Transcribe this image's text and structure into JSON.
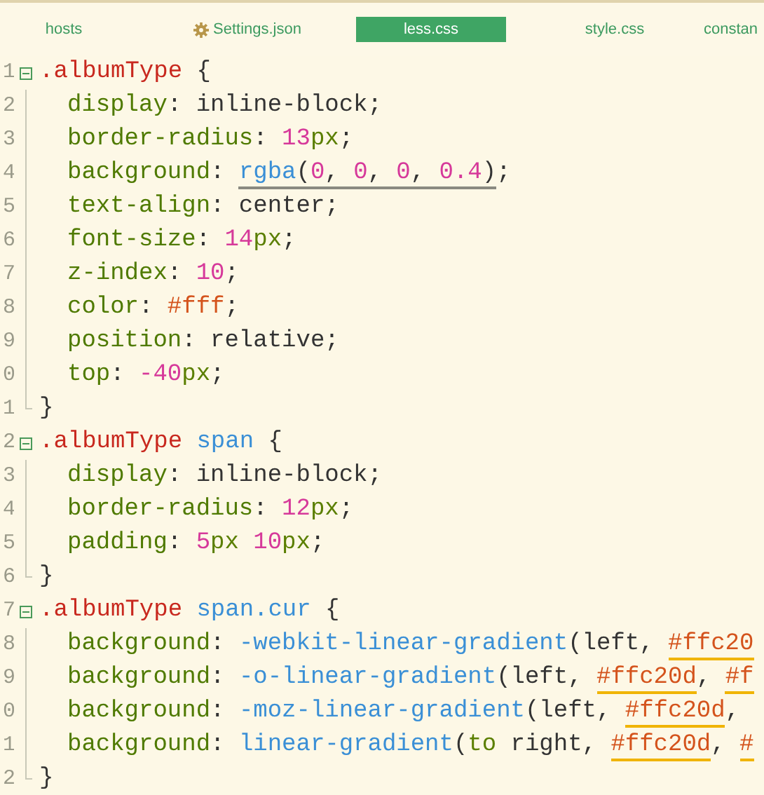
{
  "tabs": [
    {
      "label": "hosts",
      "selected": false
    },
    {
      "label": "Settings.json",
      "selected": false
    },
    {
      "label": "less.css",
      "selected": true
    },
    {
      "label": "style.css",
      "selected": false
    },
    {
      "label": "constan",
      "selected": false
    }
  ],
  "lines": [
    {
      "number": "1",
      "kind": "open",
      "tokens": [
        {
          "text": ".albumType",
          "kind": "selector"
        },
        {
          "text": " {",
          "kind": "plain"
        }
      ]
    },
    {
      "number": "2",
      "kind": "body",
      "tokens": [
        {
          "text": "display",
          "kind": "property"
        },
        {
          "text": ": inline-block;",
          "kind": "plain"
        }
      ]
    },
    {
      "number": "3",
      "kind": "body",
      "tokens": [
        {
          "text": "border-radius",
          "kind": "property"
        },
        {
          "text": ": ",
          "kind": "plain"
        },
        {
          "text": "13",
          "kind": "number"
        },
        {
          "text": "px",
          "kind": "unit"
        },
        {
          "text": ";",
          "kind": "plain"
        }
      ]
    },
    {
      "number": "4",
      "kind": "body",
      "tokens": [
        {
          "text": "background",
          "kind": "property"
        },
        {
          "text": ": ",
          "kind": "plain"
        },
        {
          "text": "rgba",
          "kind": "function",
          "underlined": true
        },
        {
          "text": "(",
          "kind": "plain",
          "underlined": true
        },
        {
          "text": "0",
          "kind": "number",
          "underlined": true
        },
        {
          "text": ", ",
          "kind": "plain",
          "underlined": true
        },
        {
          "text": "0",
          "kind": "number",
          "underlined": true
        },
        {
          "text": ", ",
          "kind": "plain",
          "underlined": true
        },
        {
          "text": "0",
          "kind": "number",
          "underlined": true
        },
        {
          "text": ", ",
          "kind": "plain",
          "underlined": true
        },
        {
          "text": "0.4",
          "kind": "number",
          "underlined": true
        },
        {
          "text": ")",
          "kind": "plain",
          "underlined": true
        },
        {
          "text": ";",
          "kind": "plain"
        }
      ]
    },
    {
      "number": "5",
      "kind": "body",
      "tokens": [
        {
          "text": "text-align",
          "kind": "property"
        },
        {
          "text": ": center;",
          "kind": "plain"
        }
      ]
    },
    {
      "number": "6",
      "kind": "body",
      "tokens": [
        {
          "text": "font-size",
          "kind": "property"
        },
        {
          "text": ": ",
          "kind": "plain"
        },
        {
          "text": "14",
          "kind": "number"
        },
        {
          "text": "px",
          "kind": "unit"
        },
        {
          "text": ";",
          "kind": "plain"
        }
      ]
    },
    {
      "number": "7",
      "kind": "body",
      "tokens": [
        {
          "text": "z-index",
          "kind": "property"
        },
        {
          "text": ": ",
          "kind": "plain"
        },
        {
          "text": "10",
          "kind": "number"
        },
        {
          "text": ";",
          "kind": "plain"
        }
      ]
    },
    {
      "number": "8",
      "kind": "body",
      "tokens": [
        {
          "text": "color",
          "kind": "property"
        },
        {
          "text": ": ",
          "kind": "plain"
        },
        {
          "text": "#fff",
          "kind": "hex"
        },
        {
          "text": ";",
          "kind": "plain"
        }
      ]
    },
    {
      "number": "9",
      "kind": "body",
      "tokens": [
        {
          "text": "position",
          "kind": "property"
        },
        {
          "text": ": relative;",
          "kind": "plain"
        }
      ]
    },
    {
      "number": "0",
      "kind": "body",
      "tokens": [
        {
          "text": "top",
          "kind": "property"
        },
        {
          "text": ": ",
          "kind": "plain"
        },
        {
          "text": "-40",
          "kind": "number"
        },
        {
          "text": "px",
          "kind": "unit"
        },
        {
          "text": ";",
          "kind": "plain"
        }
      ]
    },
    {
      "number": "1",
      "kind": "close",
      "tokens": [
        {
          "text": "}",
          "kind": "plain"
        }
      ]
    },
    {
      "number": "2",
      "kind": "open",
      "tokens": [
        {
          "text": ".albumType ",
          "kind": "selector"
        },
        {
          "text": "span",
          "kind": "function"
        },
        {
          "text": " {",
          "kind": "plain"
        }
      ]
    },
    {
      "number": "3",
      "kind": "body",
      "tokens": [
        {
          "text": "display",
          "kind": "property"
        },
        {
          "text": ": inline-block;",
          "kind": "plain"
        }
      ]
    },
    {
      "number": "4",
      "kind": "body",
      "tokens": [
        {
          "text": "border-radius",
          "kind": "property"
        },
        {
          "text": ": ",
          "kind": "plain"
        },
        {
          "text": "12",
          "kind": "number"
        },
        {
          "text": "px",
          "kind": "unit"
        },
        {
          "text": ";",
          "kind": "plain"
        }
      ]
    },
    {
      "number": "5",
      "kind": "body",
      "tokens": [
        {
          "text": "padding",
          "kind": "property"
        },
        {
          "text": ": ",
          "kind": "plain"
        },
        {
          "text": "5",
          "kind": "number"
        },
        {
          "text": "px ",
          "kind": "unit"
        },
        {
          "text": "10",
          "kind": "number"
        },
        {
          "text": "px",
          "kind": "unit"
        },
        {
          "text": ";",
          "kind": "plain"
        }
      ]
    },
    {
      "number": "6",
      "kind": "close",
      "tokens": [
        {
          "text": "}",
          "kind": "plain"
        }
      ]
    },
    {
      "number": "7",
      "kind": "open",
      "tokens": [
        {
          "text": ".albumType ",
          "kind": "selector"
        },
        {
          "text": "span.cur",
          "kind": "function"
        },
        {
          "text": " {",
          "kind": "plain"
        }
      ]
    },
    {
      "number": "8",
      "kind": "body",
      "tokens": [
        {
          "text": "background",
          "kind": "property"
        },
        {
          "text": ": ",
          "kind": "plain"
        },
        {
          "text": "-webkit-linear-gradient",
          "kind": "function"
        },
        {
          "text": "(left, ",
          "kind": "plain"
        },
        {
          "text": "#ffc20",
          "kind": "hex",
          "underlined": true
        }
      ]
    },
    {
      "number": "9",
      "kind": "body",
      "tokens": [
        {
          "text": "background",
          "kind": "property"
        },
        {
          "text": ": ",
          "kind": "plain"
        },
        {
          "text": "-o-linear-gradient",
          "kind": "function"
        },
        {
          "text": "(left, ",
          "kind": "plain"
        },
        {
          "text": "#ffc20d",
          "kind": "hex",
          "underlined": true
        },
        {
          "text": ", ",
          "kind": "plain"
        },
        {
          "text": "#f",
          "kind": "hex",
          "underlined": true
        }
      ]
    },
    {
      "number": "0",
      "kind": "body",
      "tokens": [
        {
          "text": "background",
          "kind": "property"
        },
        {
          "text": ": ",
          "kind": "plain"
        },
        {
          "text": "-moz-linear-gradient",
          "kind": "function"
        },
        {
          "text": "(left, ",
          "kind": "plain"
        },
        {
          "text": "#ffc20d",
          "kind": "hex",
          "underlined": true
        },
        {
          "text": ",",
          "kind": "plain"
        }
      ]
    },
    {
      "number": "1",
      "kind": "body",
      "tokens": [
        {
          "text": "background",
          "kind": "property"
        },
        {
          "text": ": ",
          "kind": "plain"
        },
        {
          "text": "linear-gradient",
          "kind": "function"
        },
        {
          "text": "(",
          "kind": "plain"
        },
        {
          "text": "to",
          "kind": "unit"
        },
        {
          "text": " right, ",
          "kind": "plain"
        },
        {
          "text": "#ffc20d",
          "kind": "hex",
          "underlined": true
        },
        {
          "text": ", ",
          "kind": "plain"
        },
        {
          "text": "#",
          "kind": "hex",
          "underlined": true
        }
      ]
    },
    {
      "number": "2",
      "kind": "close",
      "tokens": [
        {
          "text": "}",
          "kind": "plain"
        }
      ]
    }
  ]
}
